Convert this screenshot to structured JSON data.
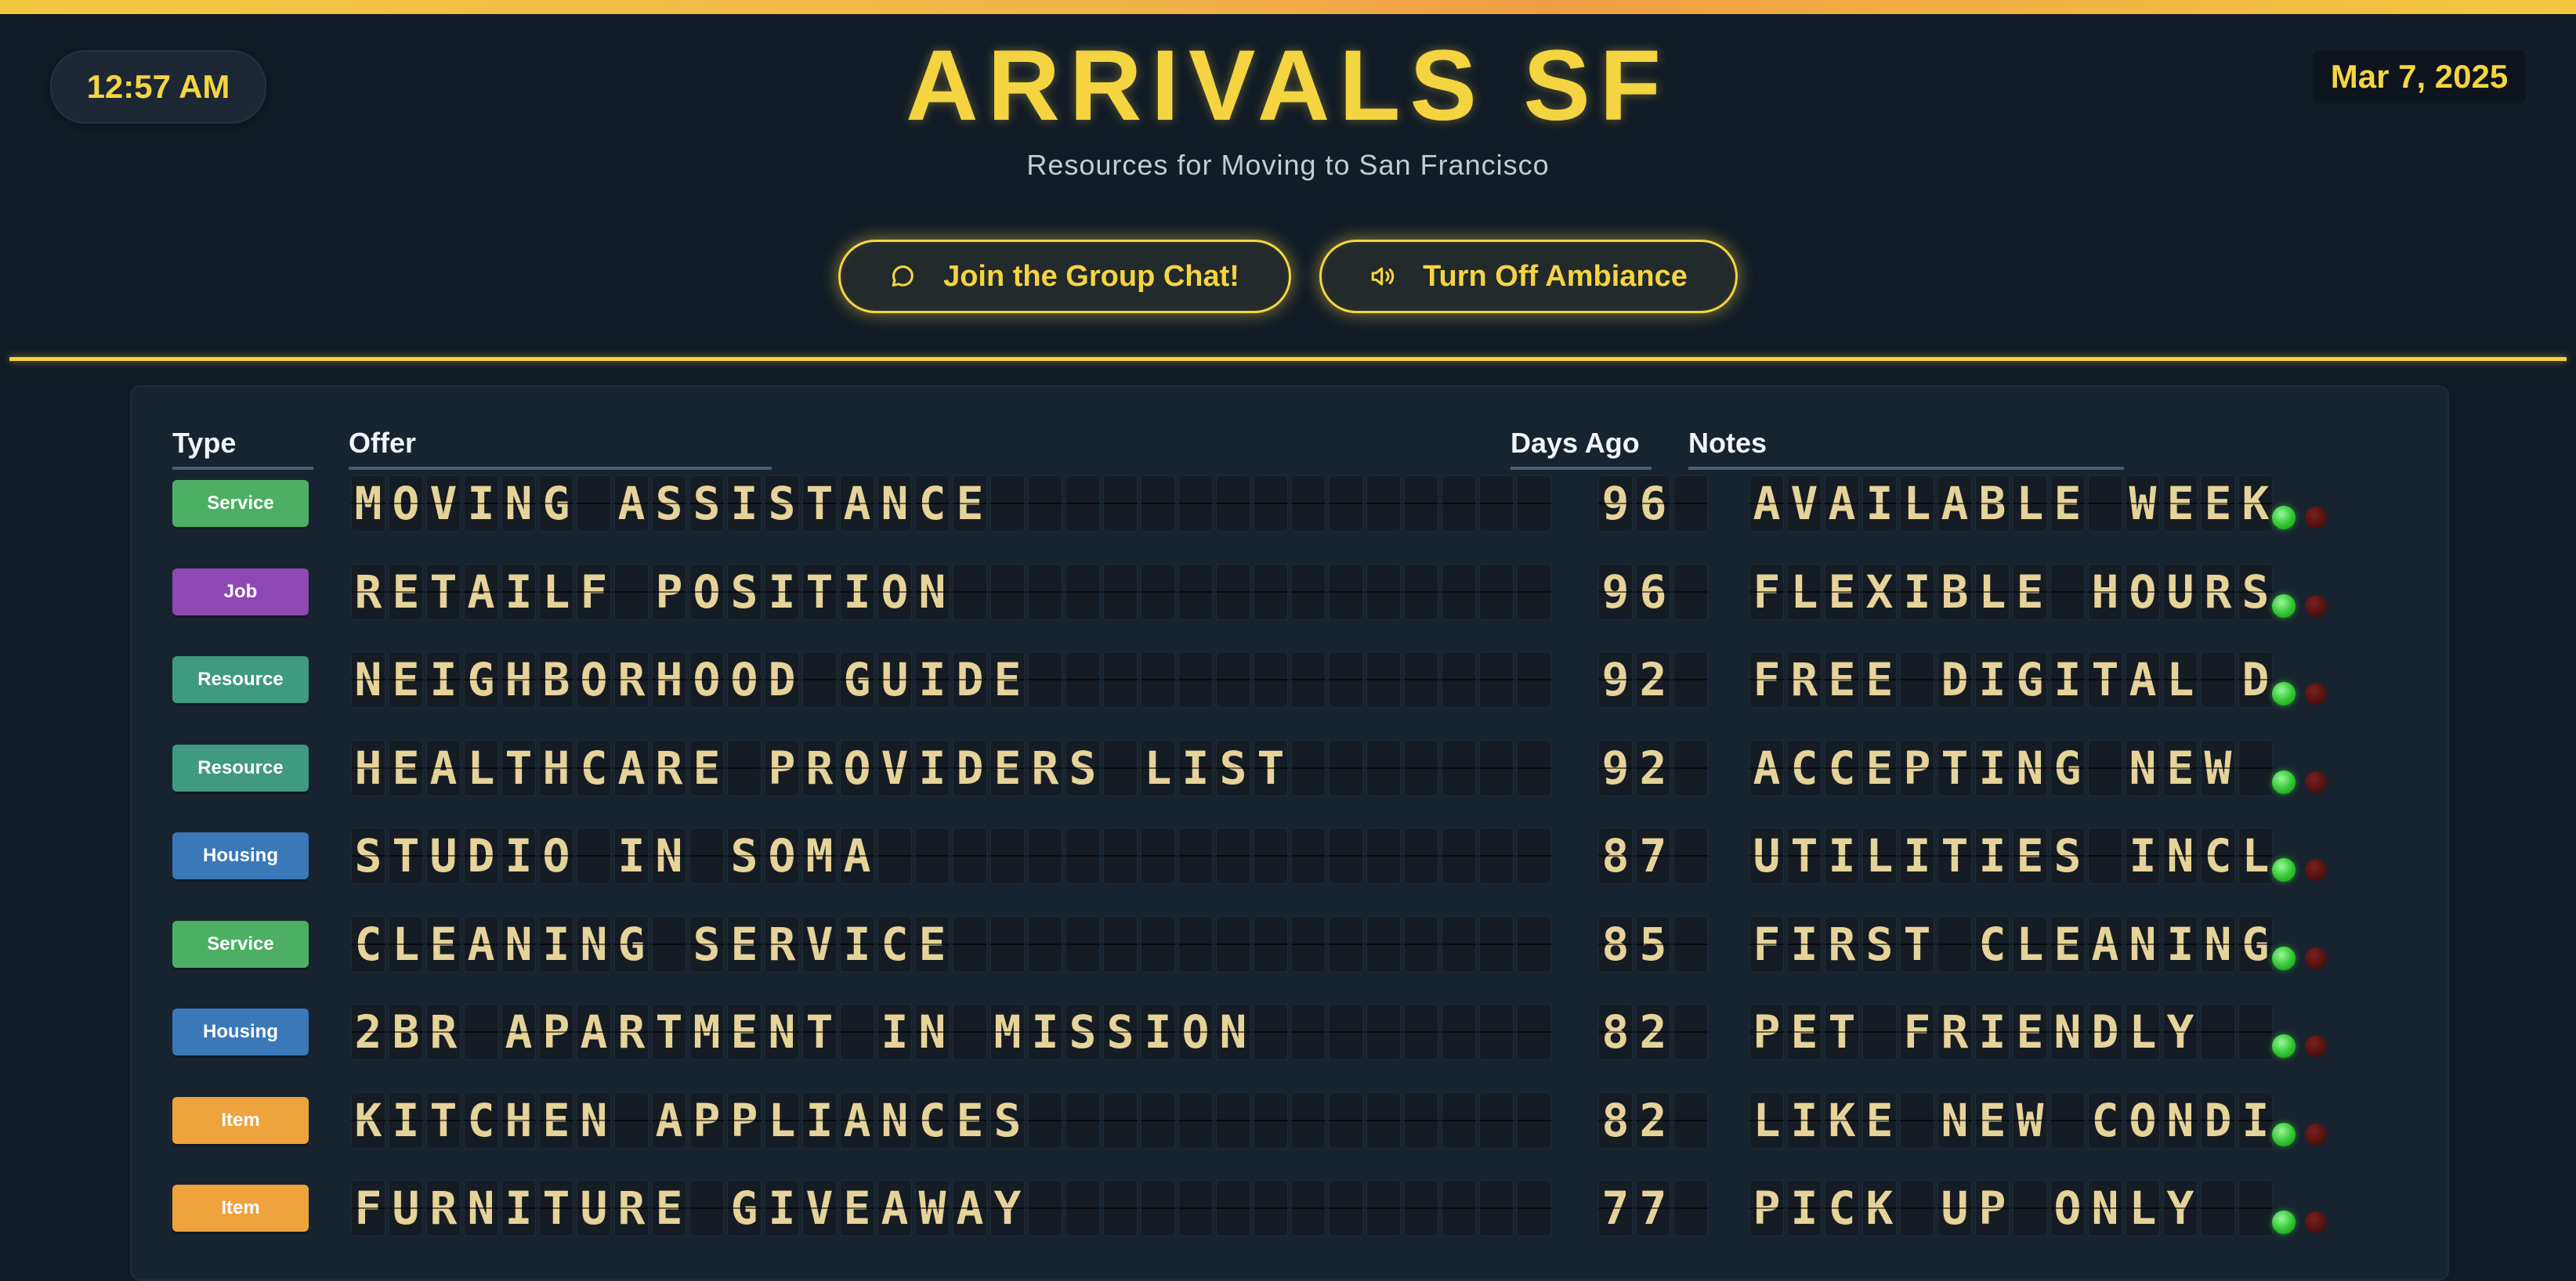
{
  "header": {
    "time": "12:57 AM",
    "date": "Mar 7, 2025",
    "title": "ARRIVALS SF",
    "subtitle": "Resources for Moving to San Francisco",
    "chat_button": "Join the Group Chat!",
    "ambiance_button": "Turn Off Ambiance"
  },
  "columns": {
    "type": "Type",
    "offer": "Offer",
    "days": "Days Ago",
    "notes": "Notes"
  },
  "colors": {
    "accent": "#f5d442",
    "Service": "#4caf63",
    "Job": "#8e47b3",
    "Resource": "#3f9a7f",
    "Housing": "#3b78b8",
    "Item": "#eea33d"
  },
  "rows": [
    {
      "type": "Service",
      "offer": "MOVING ASSISTANCE",
      "days": "96",
      "notes": "AVAILABLE WEEK"
    },
    {
      "type": "Job",
      "offer": "RETAILF POSITION",
      "days": "96",
      "notes": "FLEXIBLE HOURS"
    },
    {
      "type": "Resource",
      "offer": "NEIGHBORHOOD GUIDE",
      "days": "92",
      "notes": "FREE DIGITAL D"
    },
    {
      "type": "Resource",
      "offer": "HEALTHCARE PROVIDERS LIST",
      "days": "92",
      "notes": "ACCEPTING NEW"
    },
    {
      "type": "Housing",
      "offer": "STUDIO IN SOMA",
      "days": "87",
      "notes": "UTILITIES INCL"
    },
    {
      "type": "Service",
      "offer": "CLEANING SERVICE",
      "days": "85",
      "notes": "FIRST CLEANING"
    },
    {
      "type": "Housing",
      "offer": "2BR APARTMENT IN MISSION",
      "days": "82",
      "notes": "PET FRIENDLY"
    },
    {
      "type": "Item",
      "offer": "KITCHEN APPLIANCES",
      "days": "82",
      "notes": "LIKE NEW CONDI"
    },
    {
      "type": "Item",
      "offer": "FURNITURE GIVEAWAY",
      "days": "77",
      "notes": "PICK UP ONLY"
    }
  ]
}
